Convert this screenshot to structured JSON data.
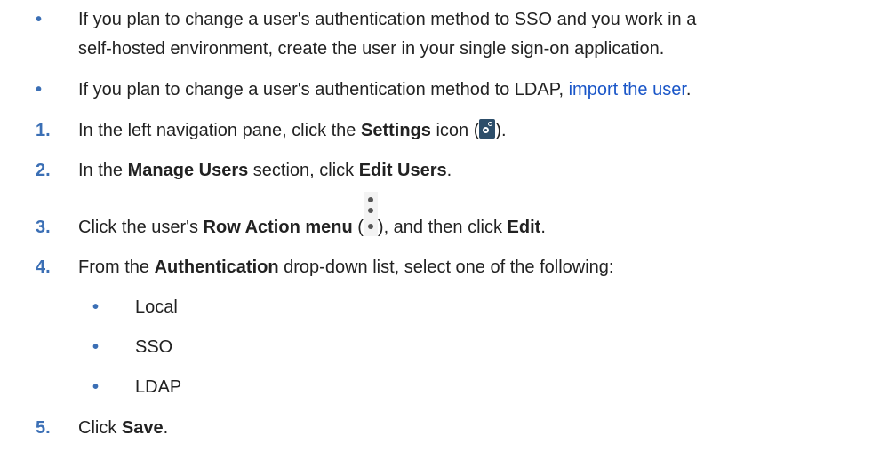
{
  "prereq": [
    {
      "line1": "If you plan to change a user's authentication method to SSO and you work in a",
      "line2": "self-hosted environment, create the user in your single sign-on application."
    },
    {
      "text": "If you plan to change a user's authentication method to LDAP, ",
      "link": "import the user",
      "after": "."
    }
  ],
  "bullet_glyph": "•",
  "steps": [
    {
      "num": "1.",
      "before": "In the left navigation pane, click the ",
      "bold": "Settings",
      "middle": " icon (",
      "icon": "settings-gear-icon",
      "after": ")."
    },
    {
      "num": "2.",
      "before": "In the ",
      "bold1": "Manage Users",
      "middle": " section, click ",
      "bold2": "Edit Users",
      "after": "."
    },
    {
      "num": "3.",
      "before": "Click the user's ",
      "bold1": "Row Action menu",
      "middle": " (",
      "icon": "kebab-menu-icon",
      "middle2": "), and then click ",
      "bold2": "Edit",
      "after": "."
    },
    {
      "num": "4.",
      "before": "From the ",
      "bold": "Authentication",
      "after": " drop-down list, select one of the following:",
      "options": [
        "Local",
        "SSO",
        "LDAP"
      ]
    },
    {
      "num": "5.",
      "before": "Click ",
      "bold": "Save",
      "after": "."
    }
  ],
  "colors": {
    "text": "#222222",
    "marker": "#3b6fb5",
    "link": "#1a56c8",
    "settings_icon_bg": "#2d4e6a"
  }
}
